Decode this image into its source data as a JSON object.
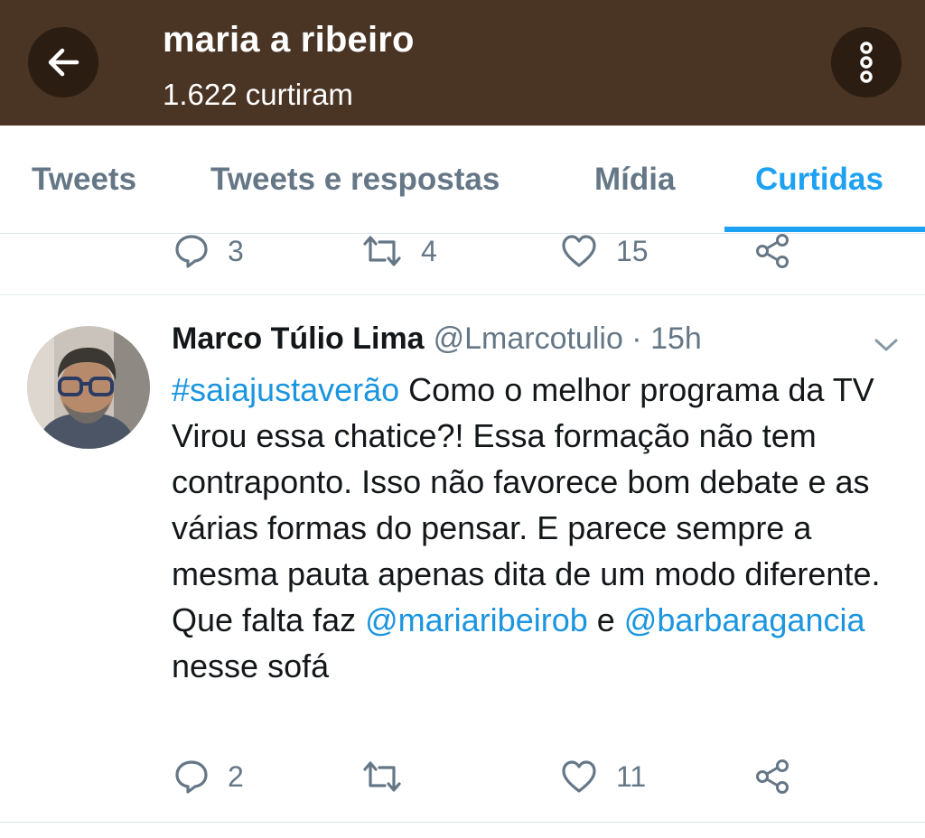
{
  "header": {
    "title": "maria a ribeiro",
    "subtitle": "1.622 curtiram",
    "back_icon": "arrow-left-icon",
    "more_icon": "vertical-dots-icon",
    "colors": {
      "background": "#4a3424",
      "button": "#2c1d12"
    }
  },
  "tabs": [
    {
      "label": "Tweets",
      "active": false
    },
    {
      "label": "Tweets e respostas",
      "active": false
    },
    {
      "label": "Mídia",
      "active": false
    },
    {
      "label": "Curtidas",
      "active": true
    }
  ],
  "previous_tweet": {
    "replies": "3",
    "retweets": "4",
    "likes": "15"
  },
  "tweet": {
    "author_name": "Marco Túlio Lima",
    "author_handle": "@Lmarcotulio · 15h",
    "hashtag": "#saiajustaverão",
    "text_1": " Como o melhor programa da TV Virou essa chatice?! Essa formação não tem contraponto. Isso não favorece bom debate e as várias formas do pensar. E parece sempre a mesma pauta apenas dita de um modo diferente. Que falta faz ",
    "mention_1": "@mariaribeirob",
    "text_2": " e ",
    "mention_2": "@barbaragancia",
    "text_3": " nesse sofá",
    "replies": "2",
    "retweets": "",
    "likes": "11"
  },
  "colors": {
    "accent": "#1da1f2",
    "link": "#1b95e0",
    "muted": "#657786",
    "text": "#14171a"
  }
}
